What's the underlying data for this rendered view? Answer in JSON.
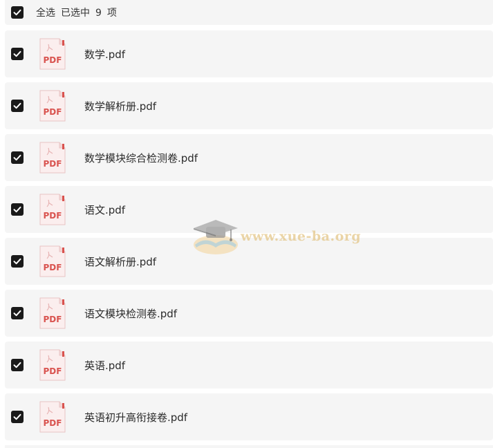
{
  "header": {
    "select_all_label": "全选",
    "selected_label": "已选中",
    "selected_count": "9",
    "unit_label": "项",
    "select_all_checked": true
  },
  "files": [
    {
      "name": "数学.pdf",
      "icon": "pdf-icon",
      "checked": true
    },
    {
      "name": "数学解析册.pdf",
      "icon": "pdf-icon",
      "checked": true
    },
    {
      "name": "数学模块综合检测卷.pdf",
      "icon": "pdf-icon",
      "checked": true
    },
    {
      "name": "语文.pdf",
      "icon": "pdf-icon",
      "checked": true
    },
    {
      "name": "语文解析册.pdf",
      "icon": "pdf-icon",
      "checked": true
    },
    {
      "name": "语文模块检测卷.pdf",
      "icon": "pdf-icon",
      "checked": true
    },
    {
      "name": "英语.pdf",
      "icon": "pdf-icon",
      "checked": true
    },
    {
      "name": "英语初升高衔接卷.pdf",
      "icon": "pdf-icon",
      "checked": true
    }
  ],
  "pdf_icon_label": "PDF",
  "watermark": {
    "text": "www.xue-ba.org",
    "icon": "graduation-cap-icon"
  },
  "colors": {
    "row_background": "#f5f5f5",
    "checkbox": "#1a1a1a",
    "pdf_red": "#d9534f"
  }
}
